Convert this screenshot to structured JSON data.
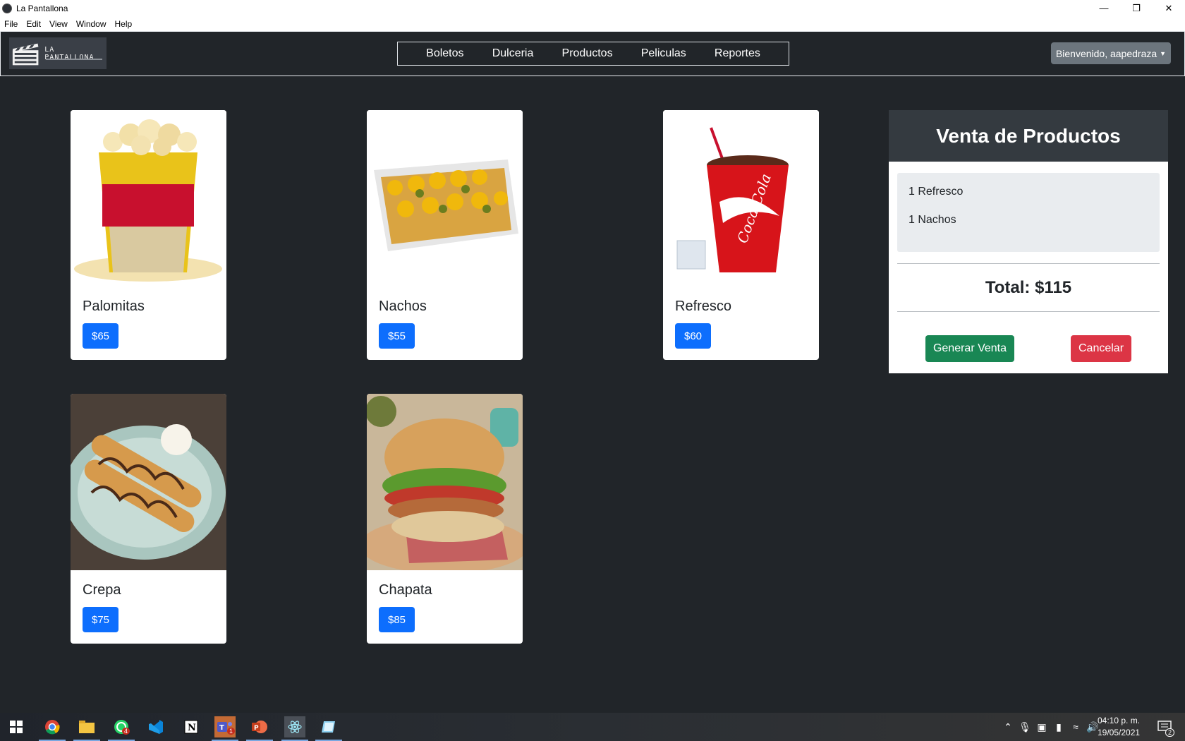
{
  "window": {
    "title": "La Pantallona",
    "controls": [
      "minimize-icon",
      "restore-icon",
      "close-icon"
    ]
  },
  "menu": [
    "File",
    "Edit",
    "View",
    "Window",
    "Help"
  ],
  "navbar": {
    "logo_text": "LA PANTALLONA",
    "links": [
      "Boletos",
      "Dulceria",
      "Productos",
      "Peliculas",
      "Reportes"
    ],
    "user": "Bienvenido, aapedraza"
  },
  "products": [
    {
      "name": "Palomitas",
      "price": "$65",
      "image": "popcorn-image"
    },
    {
      "name": "Nachos",
      "price": "$55",
      "image": "nachos-image"
    },
    {
      "name": "Refresco",
      "price": "$60",
      "image": "soda-image"
    },
    {
      "name": "Crepa",
      "price": "$75",
      "image": "crepe-image"
    },
    {
      "name": "Chapata",
      "price": "$85",
      "image": "chapata-image"
    }
  ],
  "sale": {
    "title": "Venta de Productos",
    "items": [
      "1 Refresco",
      "1 Nachos"
    ],
    "total": "Total: $115",
    "generate_label": "Generar Venta",
    "cancel_label": "Cancelar",
    "colors": {
      "generate": "#198754",
      "cancel": "#dc3545",
      "price": "#0d6efd"
    }
  },
  "taskbar": {
    "apps": [
      "windows-start-icon",
      "chrome-icon",
      "file-explorer-icon",
      "whatsapp-icon",
      "vscode-icon",
      "notion-icon",
      "teams-icon",
      "powerpoint-icon",
      "electron-app-icon",
      "notes-app-icon"
    ],
    "whatsapp_badge": "4",
    "teams_badge": "1",
    "time": "04:10 p. m.",
    "date": "19/05/2021",
    "notification_count": "2"
  }
}
